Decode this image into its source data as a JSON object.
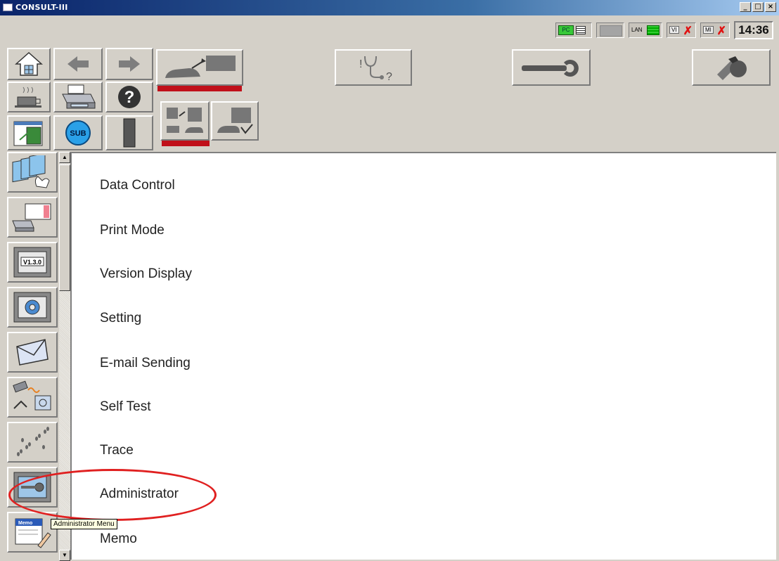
{
  "window": {
    "title": "CONSULT-III",
    "buttons": {
      "minimize": "_",
      "maximize": "□",
      "close": "×"
    }
  },
  "status": {
    "pc_label": "PC",
    "lan_label": "LAN",
    "vi_label": "VI",
    "mi_label": "MI",
    "error_mark": "✗",
    "clock": "14:36"
  },
  "menu": {
    "items": [
      {
        "label": "Data Control"
      },
      {
        "label": "Print Mode"
      },
      {
        "label": "Version Display"
      },
      {
        "label": "Setting"
      },
      {
        "label": "E-mail Sending"
      },
      {
        "label": "Self Test"
      },
      {
        "label": "Trace"
      },
      {
        "label": "Administrator"
      },
      {
        "label": "Memo"
      }
    ]
  },
  "sidebar": {
    "version_badge": "V1.3.0",
    "memo_badge": "Memo"
  },
  "toolbar": {
    "sub_label": "SUB",
    "help_glyph": "?"
  },
  "tooltip": "Administrator Menu",
  "colors": {
    "accent_red": "#c0101a",
    "highlight_red": "#e02020",
    "status_green": "#38c838"
  }
}
